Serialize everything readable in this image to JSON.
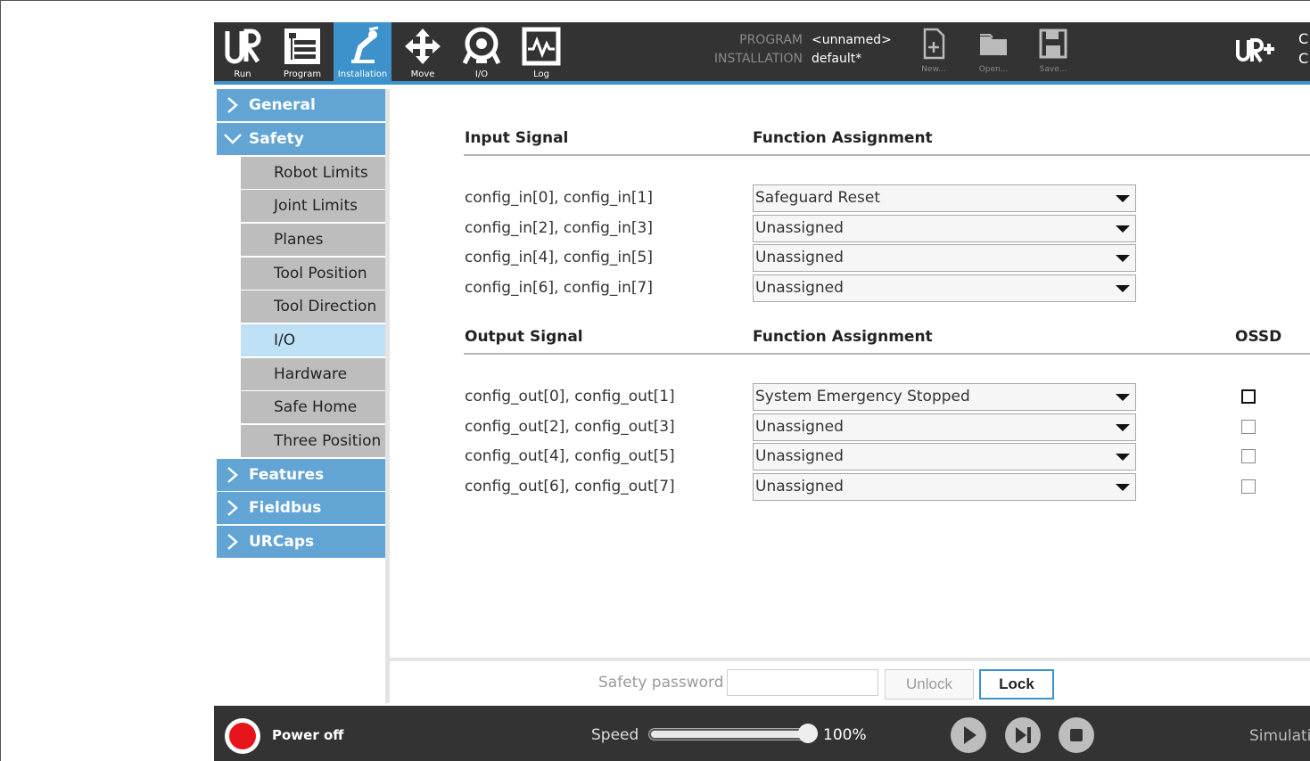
{
  "topbar": {
    "tabs": [
      {
        "label": "Run",
        "icon": "ur-logo-icon"
      },
      {
        "label": "Program",
        "icon": "program-icon"
      },
      {
        "label": "Installation",
        "icon": "installation-icon",
        "active": true
      },
      {
        "label": "Move",
        "icon": "move-arrows-icon"
      },
      {
        "label": "I/O",
        "icon": "io-icon"
      },
      {
        "label": "Log",
        "icon": "log-icon"
      }
    ],
    "program_key": "PROGRAM",
    "program_value": "<unnamed>",
    "installation_key": "INSTALLATION",
    "installation_value": "default*",
    "file_buttons": [
      {
        "label": "New...",
        "icon": "new-file-icon"
      },
      {
        "label": "Open...",
        "icon": "folder-icon"
      },
      {
        "label": "Save...",
        "icon": "save-icon"
      }
    ],
    "cut_text_1": "C",
    "cut_text_2": "C"
  },
  "sidebar": {
    "general": "General",
    "safety": "Safety",
    "safety_items": [
      "Robot Limits",
      "Joint Limits",
      "Planes",
      "Tool Position",
      "Tool Direction",
      "I/O",
      "Hardware",
      "Safe Home",
      "Three Position"
    ],
    "selected_item": "I/O",
    "features": "Features",
    "fieldbus": "Fieldbus",
    "urcaps": "URCaps"
  },
  "io": {
    "input_header": "Input Signal",
    "input_function_header": "Function Assignment",
    "inputs": [
      {
        "signal": "config_in[0], config_in[1]",
        "assignment": "Safeguard Reset"
      },
      {
        "signal": "config_in[2], config_in[3]",
        "assignment": "Unassigned"
      },
      {
        "signal": "config_in[4], config_in[5]",
        "assignment": "Unassigned"
      },
      {
        "signal": "config_in[6], config_in[7]",
        "assignment": "Unassigned"
      }
    ],
    "output_header": "Output Signal",
    "output_function_header": "Function Assignment",
    "ossd_header": "OSSD",
    "outputs": [
      {
        "signal": "config_out[0], config_out[1]",
        "assignment": "System Emergency Stopped",
        "ossd": false
      },
      {
        "signal": "config_out[2], config_out[3]",
        "assignment": "Unassigned",
        "ossd": false
      },
      {
        "signal": "config_out[4], config_out[5]",
        "assignment": "Unassigned",
        "ossd": false
      },
      {
        "signal": "config_out[6], config_out[7]",
        "assignment": "Unassigned",
        "ossd": false
      }
    ]
  },
  "password": {
    "label": "Safety password",
    "value": "",
    "unlock": "Unlock",
    "lock": "Lock"
  },
  "footer": {
    "power": "Power off",
    "speed_label": "Speed",
    "speed_fraction": 1.0,
    "speed_value": "100%",
    "simulation": "Simulation"
  },
  "colors": {
    "accent": "#3d92cc",
    "nav": "#62a4d4",
    "selected": "#bfe1f6",
    "bar": "#333333",
    "power": "#e8141b"
  }
}
